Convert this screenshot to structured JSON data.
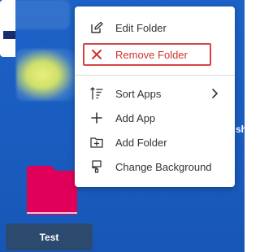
{
  "background": {
    "right_tile_label": "sh"
  },
  "folder": {
    "name": "Test",
    "color": "#e0005a"
  },
  "context_menu": {
    "edit_folder": "Edit Folder",
    "remove_folder": "Remove Folder",
    "sort_apps": "Sort Apps",
    "add_app": "Add App",
    "add_folder": "Add Folder",
    "change_background": "Change Background"
  },
  "colors": {
    "desktop_bg": "#1c62c7",
    "danger": "#d0342c",
    "highlight_border": "#d64545",
    "label_bg": "#2c4a6e"
  },
  "icons": {
    "edit": "edit-icon",
    "remove": "close-icon",
    "sort": "sort-icon",
    "add": "plus-icon",
    "add_folder": "folder-plus-icon",
    "background": "paint-roller-icon",
    "submenu": "chevron-right-icon"
  }
}
